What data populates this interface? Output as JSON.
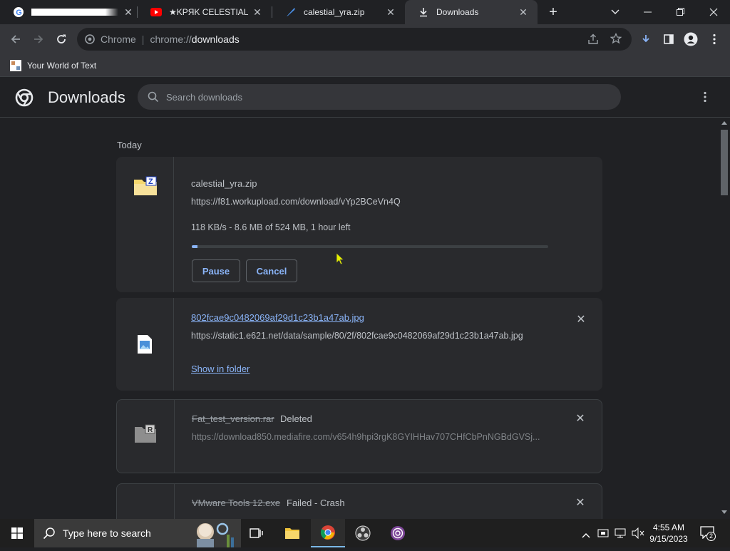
{
  "tabs": [
    {
      "title": ""
    },
    {
      "title": "★KPЯK CELESTIAL REC"
    },
    {
      "title": "calestial_yra.zip"
    },
    {
      "title": "Downloads"
    }
  ],
  "toolbar": {
    "site_label": "Chrome",
    "url_scheme": "chrome://",
    "url_path": "downloads"
  },
  "bookmarks": [
    {
      "label": "Your World of Text"
    }
  ],
  "downloads_page": {
    "title": "Downloads",
    "search_placeholder": "Search downloads",
    "section_today": "Today"
  },
  "downloads": [
    {
      "filename": "calestial_yra.zip",
      "url": "https://f81.workupload.com/download/vYp2BCeVn4Q",
      "progress_text": "118 KB/s - 8.6 MB of 524 MB, 1 hour left",
      "progress_fraction": 0.016,
      "pause_label": "Pause",
      "cancel_label": "Cancel"
    },
    {
      "filename": "802fcae9c0482069af29d1c23b1a47ab.jpg",
      "url": "https://static1.e621.net/data/sample/80/2f/802fcae9c0482069af29d1c23b1a47ab.jpg",
      "show_in_folder_label": "Show in folder"
    },
    {
      "filename": "Fat_test_version.rar",
      "status": "Deleted",
      "url": "https://download850.mediafire.com/v654h9hpi3rgK8GYIHHav707CHfCbPnNGBdGVSj..."
    },
    {
      "filename": "VMware Tools 12.exe",
      "status": "Failed - Crash"
    }
  ],
  "taskbar": {
    "search_placeholder": "Type here to search",
    "time": "4:55 AM",
    "date": "9/15/2023",
    "notification_count": "2"
  },
  "colors": {
    "accent_blue": "#8ab4f8",
    "bg_dark": "#202124",
    "card_bg": "#292a2d",
    "toolbar_bg": "#35363a"
  }
}
